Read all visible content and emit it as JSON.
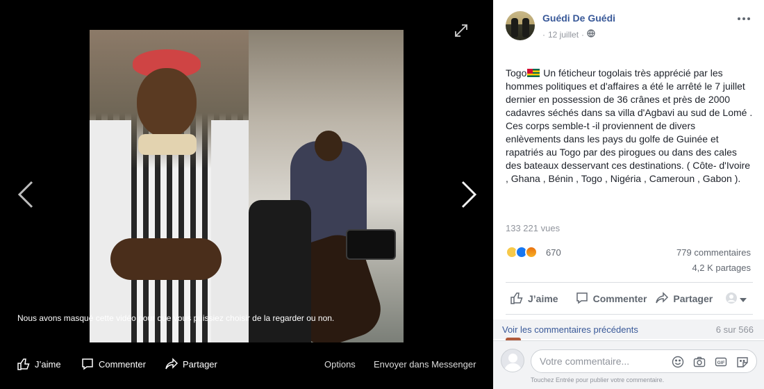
{
  "viewer": {
    "notice": "Nous avons masqué cette vidéo pour que vous puissiez choisir de la regarder ou non.",
    "bottom_bar": {
      "like": "J’aime",
      "comment": "Commenter",
      "share": "Partager",
      "options": "Options",
      "messenger": "Envoyer dans Messenger"
    },
    "icons": [
      "expand-icon",
      "chevron-left-icon",
      "chevron-right-icon"
    ]
  },
  "post": {
    "page_name": "Guédi De Guédi",
    "date": "12 juillet",
    "separator": "·",
    "privacy_icon": "globe-icon",
    "text_prefix": "Togo",
    "text_body": " Un féticheur togolais très apprécié par les hommes politiques et d'affaires a été le arrêté le 7 juillet dernier en possession de 36 crânes et près de 2000 cadavres séchés dans sa villa d'Agbavi au sud de Lomé . Ces corps semble-t -il proviennent de divers enlèvements dans les pays du golfe de Guinée et rapatriés au Togo par des pirogues ou dans des cales des bateaux desservant ces destinations. ( Côte- d'Ivoire , Ghana , Bénin , Togo , Nigéria , Cameroun , Gabon ).",
    "views": "133 221 vues",
    "reactions_count": "670",
    "reaction_types": [
      "sad",
      "like",
      "angry"
    ],
    "comments": "779 commentaires",
    "shares": "4,2 K partages"
  },
  "actions": {
    "like": "J’aime",
    "comment": "Commenter",
    "share": "Partager"
  },
  "comments_section": {
    "previous_link": "Voir les commentaires précédents",
    "count": "6 sur 566",
    "placeholder": "Votre commentaire...",
    "hint": "Touchez Entrée pour publier votre commentaire.",
    "box_icons": [
      "emoji-icon",
      "camera-icon",
      "gif-icon",
      "sticker-icon"
    ]
  },
  "colors": {
    "link": "#385898",
    "muted": "#90949c",
    "background_dark": "#000000"
  }
}
